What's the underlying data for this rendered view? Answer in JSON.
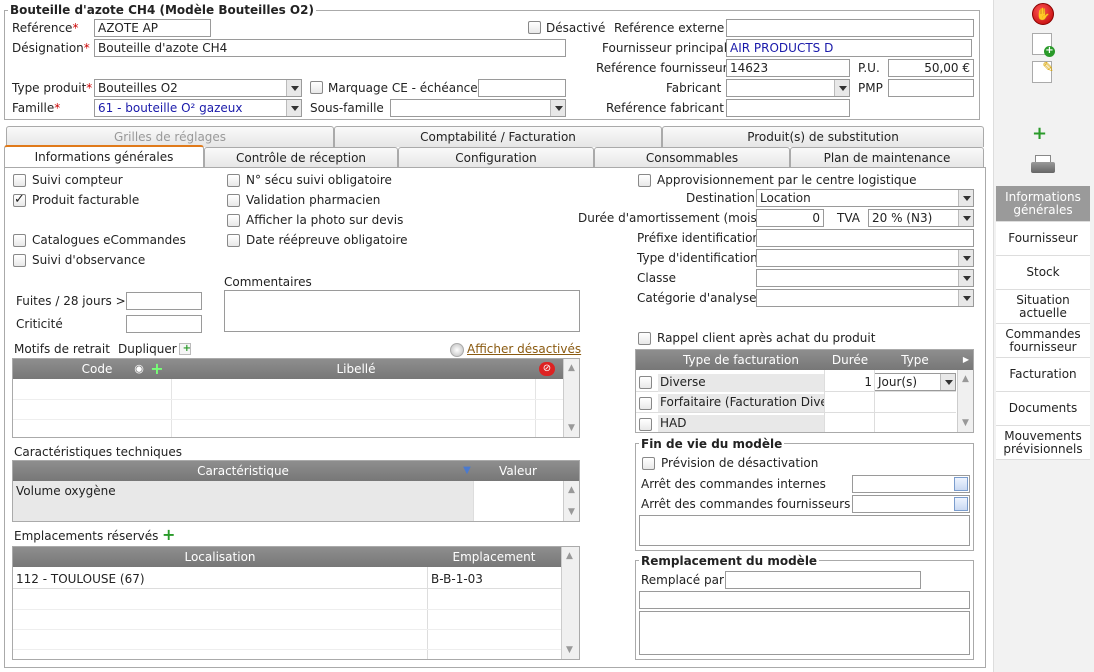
{
  "header": {
    "title": "Bouteille d'azote CH4 (Modèle Bouteilles O2)",
    "reference_label": "Reférence",
    "reference_value": "AZOTE AP",
    "designation_label": "Désignation",
    "designation_value": "Bouteille d'azote CH4",
    "desactive_label": "Désactivé",
    "ref_externe_label": "Reférence externe",
    "ref_externe_value": "",
    "fournisseur_principal_label": "Fournisseur principal",
    "fournisseur_principal_value": "AIR PRODUCTS     D",
    "ref_fournisseur_label": "Reférence fournisseur",
    "ref_fournisseur_value": "14623",
    "pu_label": "P.U.",
    "pu_value": "50,00 €",
    "type_produit_label": "Type produit",
    "type_produit_value": "Bouteilles O2",
    "marquage_label": "Marquage CE - échéance",
    "marquage_value": "",
    "fabricant_label": "Fabricant",
    "fabricant_value": "",
    "pmp_label": "PMP",
    "pmp_value": "",
    "famille_label": "Famille",
    "famille_value": "61 - bouteille O² gazeux",
    "sous_famille_label": "Sous-famille",
    "sous_famille_value": "",
    "ref_fabricant_label": "Reférence fabricant",
    "ref_fabricant_value": ""
  },
  "tabs_top": [
    "Grilles de réglages",
    "Comptabilité / Facturation",
    "Produit(s) de substitution"
  ],
  "tabs_bottom": [
    "Informations générales",
    "Contrôle de réception",
    "Configuration",
    "Consommables",
    "Plan de maintenance"
  ],
  "general": {
    "suivi_compteur": "Suivi compteur",
    "produit_facturable": "Produit facturable",
    "catalogues": "Catalogues eCommandes",
    "suivi_observance": "Suivi d'observance",
    "n_secu": "N° sécu suivi obligatoire",
    "validation_pharmacien": "Validation pharmacien",
    "afficher_photo": "Afficher la photo sur devis",
    "date_reepreuve": "Date réépreuve obligatoire",
    "commentaires_label": "Commentaires",
    "fuites_label": "Fuites / 28 jours >",
    "fuites_value": "",
    "criticite_label": "Criticité",
    "criticite_value": "",
    "motifs_label": "Motifs de retrait",
    "dupliquer_label": "Dupliquer",
    "afficher_desactives": "Afficher désactivés",
    "motifs_cols": [
      "Code",
      "Libellé"
    ],
    "caract_label": "Caractéristiques techniques",
    "caract_cols": [
      "Caractéristique",
      "Valeur"
    ],
    "caract_rows": [
      {
        "name": "Volume oxygène",
        "value": ""
      }
    ],
    "emplacements_label": "Emplacements réservés",
    "empl_cols": [
      "Localisation",
      "Emplacement"
    ],
    "empl_rows": [
      {
        "loc": "112 - TOULOUSE (67)",
        "empl": "B-B-1-03"
      }
    ]
  },
  "right": {
    "approvisionnement": "Approvisionnement par le centre logistique",
    "destination_label": "Destination",
    "destination_value": "Location",
    "duree_label": "Durée d'amortissement (mois)",
    "duree_value": "0",
    "tva_label": "TVA",
    "tva_value": "20 % (N3)",
    "prefixe_label": "Préfixe identification",
    "prefixe_value": "",
    "type_ident_label": "Type d'identification",
    "type_ident_value": "",
    "classe_label": "Classe",
    "classe_value": "",
    "categorie_label": "Catégorie d'analyse",
    "categorie_value": "",
    "rappel_label": "Rappel client après achat du produit",
    "fact_cols": [
      "Type de facturation",
      "Durée",
      "Type"
    ],
    "fact_rows": [
      {
        "name": "Diverse",
        "duree": "1",
        "type": "Jour(s)"
      },
      {
        "name": "Forfaitaire (Facturation Diver",
        "duree": "",
        "type": ""
      },
      {
        "name": "HAD",
        "duree": "",
        "type": ""
      }
    ],
    "fin_vie_title": "Fin de vie du modèle",
    "prevision_label": "Prévision de désactivation",
    "arret_internes_label": "Arrêt des commandes internes",
    "arret_fournisseurs_label": "Arrêt des commandes fournisseurs",
    "remplacement_title": "Remplacement du modèle",
    "remplace_par_label": "Remplacé par",
    "remplace_par_value": ""
  },
  "sidebar": [
    "Informations générales",
    "Fournisseur",
    "Stock",
    "Situation actuelle",
    "Commandes fournisseur",
    "Facturation",
    "Documents",
    "Mouvements prévisionnels"
  ],
  "colors": {
    "accent": "#e07a1a",
    "required": "#cc0000",
    "link": "#1a1aaa"
  }
}
